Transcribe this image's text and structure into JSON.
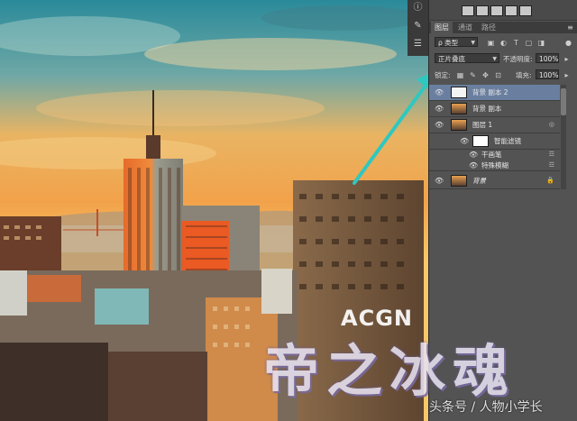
{
  "adjustments_row": {
    "icons": [
      "levels-icon",
      "curves-icon",
      "exposure-icon",
      "gradient-map-icon",
      "color-balance-icon"
    ]
  },
  "tabs": [
    {
      "label": "图层",
      "active": true
    },
    {
      "label": "通道",
      "active": false
    },
    {
      "label": "路径",
      "active": false
    }
  ],
  "filter": {
    "kind_label": "ρ 类型"
  },
  "blend": {
    "mode": "正片叠底",
    "opacity_label": "不透明度:",
    "opacity_value": "100%"
  },
  "lock": {
    "label": "锁定:",
    "fill_label": "填充:",
    "fill_value": "100%"
  },
  "layers": [
    {
      "name": "背景 副本 2",
      "selected": true,
      "thumb": "white"
    },
    {
      "name": "背景 副本",
      "selected": false,
      "thumb": "photo"
    },
    {
      "name": "图层 1",
      "selected": false,
      "thumb": "photo"
    },
    {
      "name": "智能滤镜",
      "selected": false,
      "thumb": "mask",
      "indent": 1
    },
    {
      "name": "干画笔",
      "selected": false,
      "thumb": "none",
      "indent": 2
    },
    {
      "name": "特殊模糊",
      "selected": false,
      "thumb": "none",
      "indent": 2
    },
    {
      "name": "背景",
      "selected": false,
      "thumb": "photo",
      "italic": true,
      "locked": true
    }
  ],
  "watermark": {
    "latin": "ACGN",
    "big": "帝之冰魂",
    "credit": "头条号 / 人物小学长"
  },
  "colors": {
    "arrow": "#2ec8c0",
    "selected_layer": "#6a7fa0",
    "panel": "#535353"
  }
}
